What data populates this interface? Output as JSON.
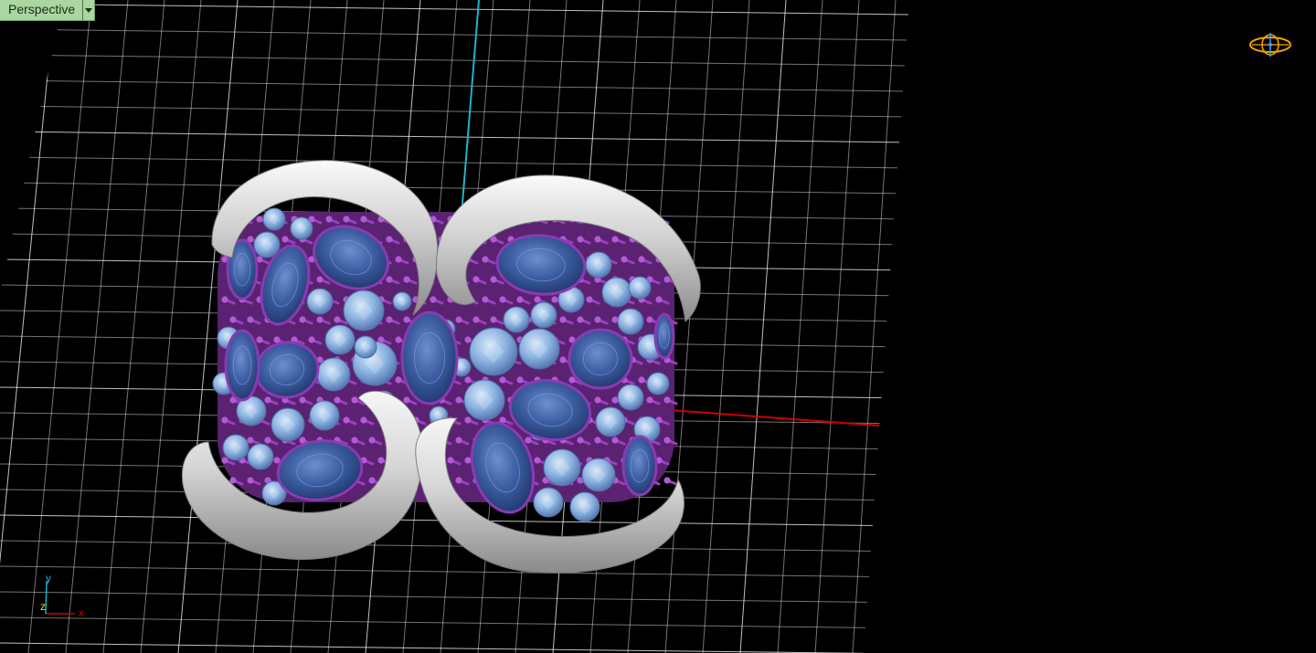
{
  "viewport": {
    "name": "Perspective"
  },
  "axis_indicator": {
    "x_label": "x",
    "y_label": "y",
    "z_label": "z"
  },
  "colors": {
    "background": "#000000",
    "grid_line": "#ffffff",
    "x_axis": "#d10000",
    "y_axis": "#1fb3c8",
    "tab_background": "#a9d6a1",
    "metal": "#d9d9d9",
    "prong": "#9b3fc0",
    "oval_stone": "#3b5da0",
    "round_stone": "#8db4e2",
    "nav_widget": "#f2a300"
  },
  "icons": {
    "tab_dropdown": "chevron-down-icon",
    "navigation": "orbit-navigation-icon"
  }
}
